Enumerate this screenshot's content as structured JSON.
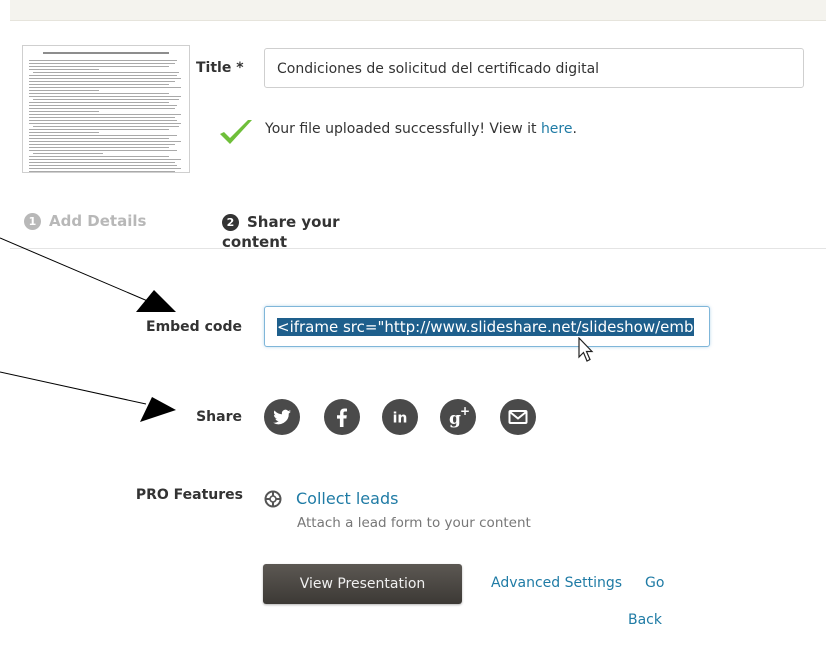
{
  "form": {
    "title_label": "Title *",
    "title_value": "Condiciones de solicitud del certificado digital",
    "success_text": "Your file uploaded successfully! View it ",
    "success_link": "here",
    "success_end": "."
  },
  "steps": [
    {
      "number": "1",
      "label": "Add Details",
      "state": "inactive"
    },
    {
      "number": "2",
      "label": "Share your content",
      "state": "active"
    }
  ],
  "embed": {
    "label": "Embed code",
    "value": "<iframe src=\"http://www.slideshare.net/slideshow/emb"
  },
  "share": {
    "label": "Share",
    "icons": [
      "twitter-icon",
      "facebook-icon",
      "linkedin-icon",
      "google-plus-icon",
      "email-icon"
    ]
  },
  "pro": {
    "label": "PRO Features",
    "link": "Collect leads",
    "description": "Attach a lead form to your content"
  },
  "actions": {
    "view_presentation": "View Presentation",
    "advanced_settings": "Advanced Settings",
    "go": "Go",
    "back": "Back"
  },
  "colors": {
    "link": "#1f7ba5",
    "success_check": "#6fbf3a",
    "selection": "#1e5f8c",
    "button": "#4a4640"
  }
}
